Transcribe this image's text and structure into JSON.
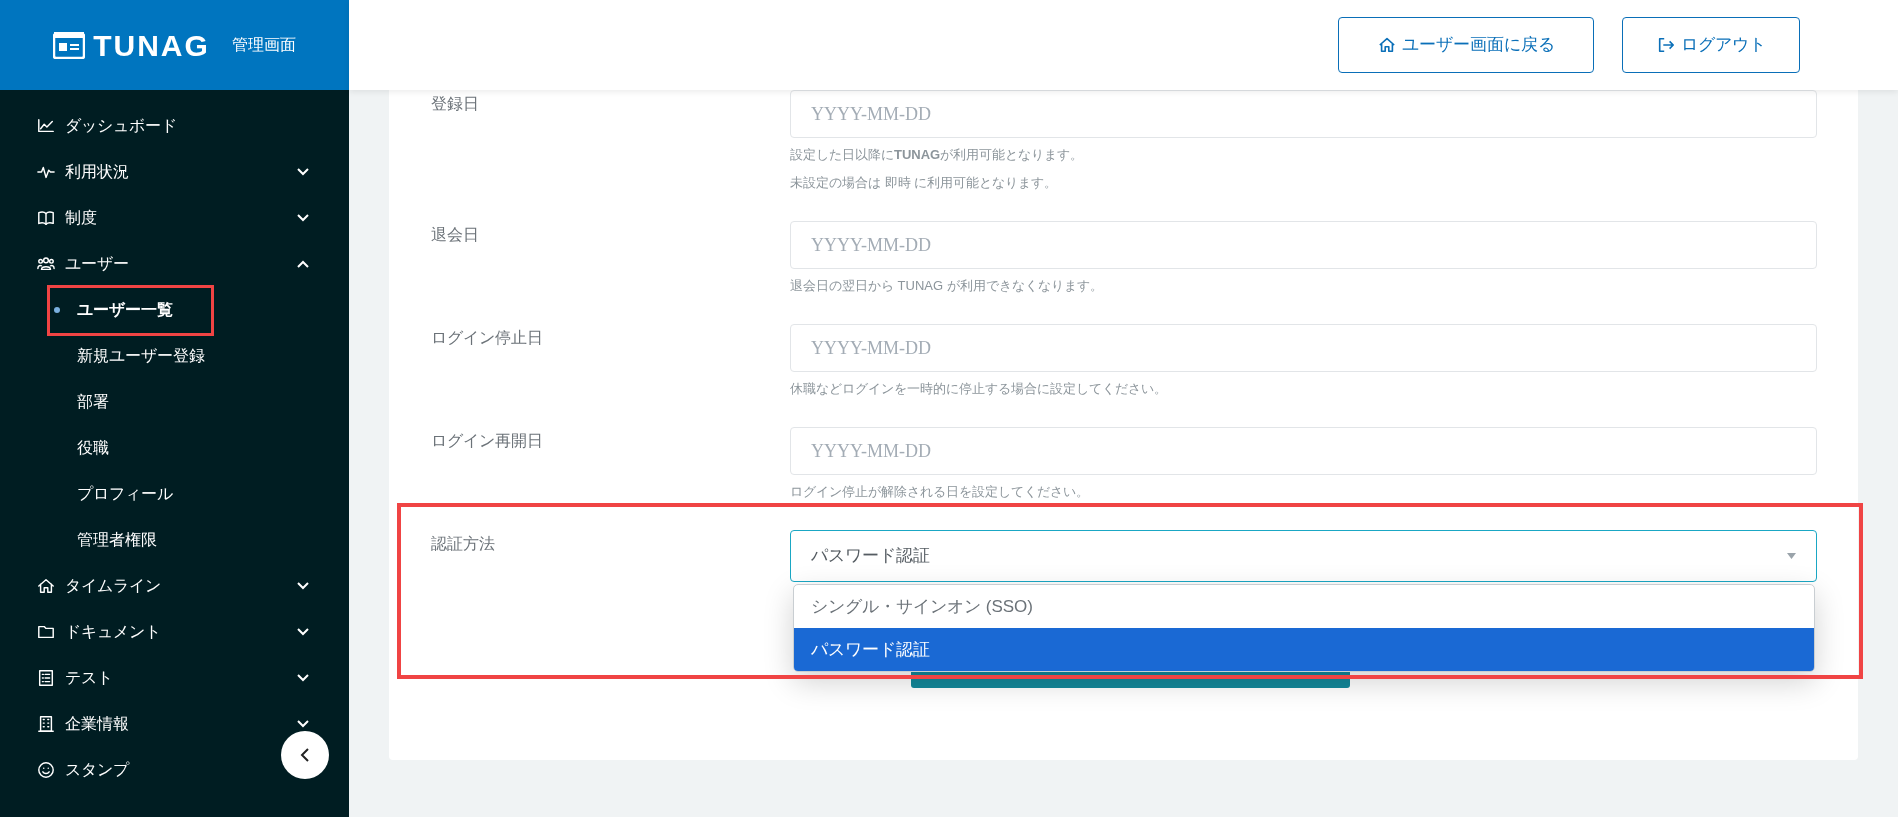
{
  "brand": {
    "logo": "TUNAG",
    "subtitle": "管理画面"
  },
  "header": {
    "buttons": [
      "ユーザー画面に戻る",
      "ログアウト"
    ]
  },
  "sidebar": {
    "items": [
      {
        "kind": "link",
        "label": "ダッシュボード"
      },
      {
        "kind": "group",
        "label": "利用状況",
        "expanded": false
      },
      {
        "kind": "group",
        "label": "制度",
        "expanded": false
      },
      {
        "kind": "group",
        "label": "ユーザー",
        "expanded": true,
        "children": [
          {
            "label": "ユーザー一覧",
            "selected": true,
            "highlighted": true
          },
          {
            "label": "新規ユーザー登録",
            "selected": false,
            "highlighted": false
          },
          {
            "label": "部署",
            "selected": false,
            "highlighted": false
          },
          {
            "label": "役職",
            "selected": false,
            "highlighted": false
          },
          {
            "label": "プロフィール",
            "selected": false,
            "highlighted": false
          },
          {
            "label": "管理者権限",
            "selected": false,
            "highlighted": false
          }
        ]
      },
      {
        "kind": "group",
        "label": "タイムライン",
        "expanded": false
      },
      {
        "kind": "group",
        "label": "ドキュメント",
        "expanded": false
      },
      {
        "kind": "group",
        "label": "テスト",
        "expanded": false
      },
      {
        "kind": "group",
        "label": "企業情報",
        "expanded": false
      },
      {
        "kind": "link",
        "label": "スタンプ"
      }
    ]
  },
  "form": {
    "fields": [
      {
        "kind": "date",
        "label": "登録日",
        "placeholder": "YYYY-MM-DD",
        "hints": [
          "設定した日以降に**TUNAG**が利用可能となります。",
          "未設定の場合は 即時 に利用可能となります。"
        ]
      },
      {
        "kind": "date",
        "label": "退会日",
        "placeholder": "YYYY-MM-DD",
        "hints": [
          "退会日の翌日から TUNAG が利用できなくなります。"
        ]
      },
      {
        "kind": "date",
        "label": "ログイン停止日",
        "placeholder": "YYYY-MM-DD",
        "hints": [
          "休職などログインを一時的に停止する場合に設定してください。"
        ]
      },
      {
        "kind": "date",
        "label": "ログイン再開日",
        "placeholder": "YYYY-MM-DD",
        "hints": [
          "ログイン停止が解除される日を設定してください。"
        ]
      },
      {
        "kind": "select",
        "label": "認証方法",
        "value": "パスワード認証",
        "expanded": true,
        "highlighted": true,
        "options": [
          {
            "label": "シングル・サインオン (SSO)",
            "selected": false
          },
          {
            "label": "パスワード認証",
            "selected": true
          }
        ]
      }
    ]
  }
}
